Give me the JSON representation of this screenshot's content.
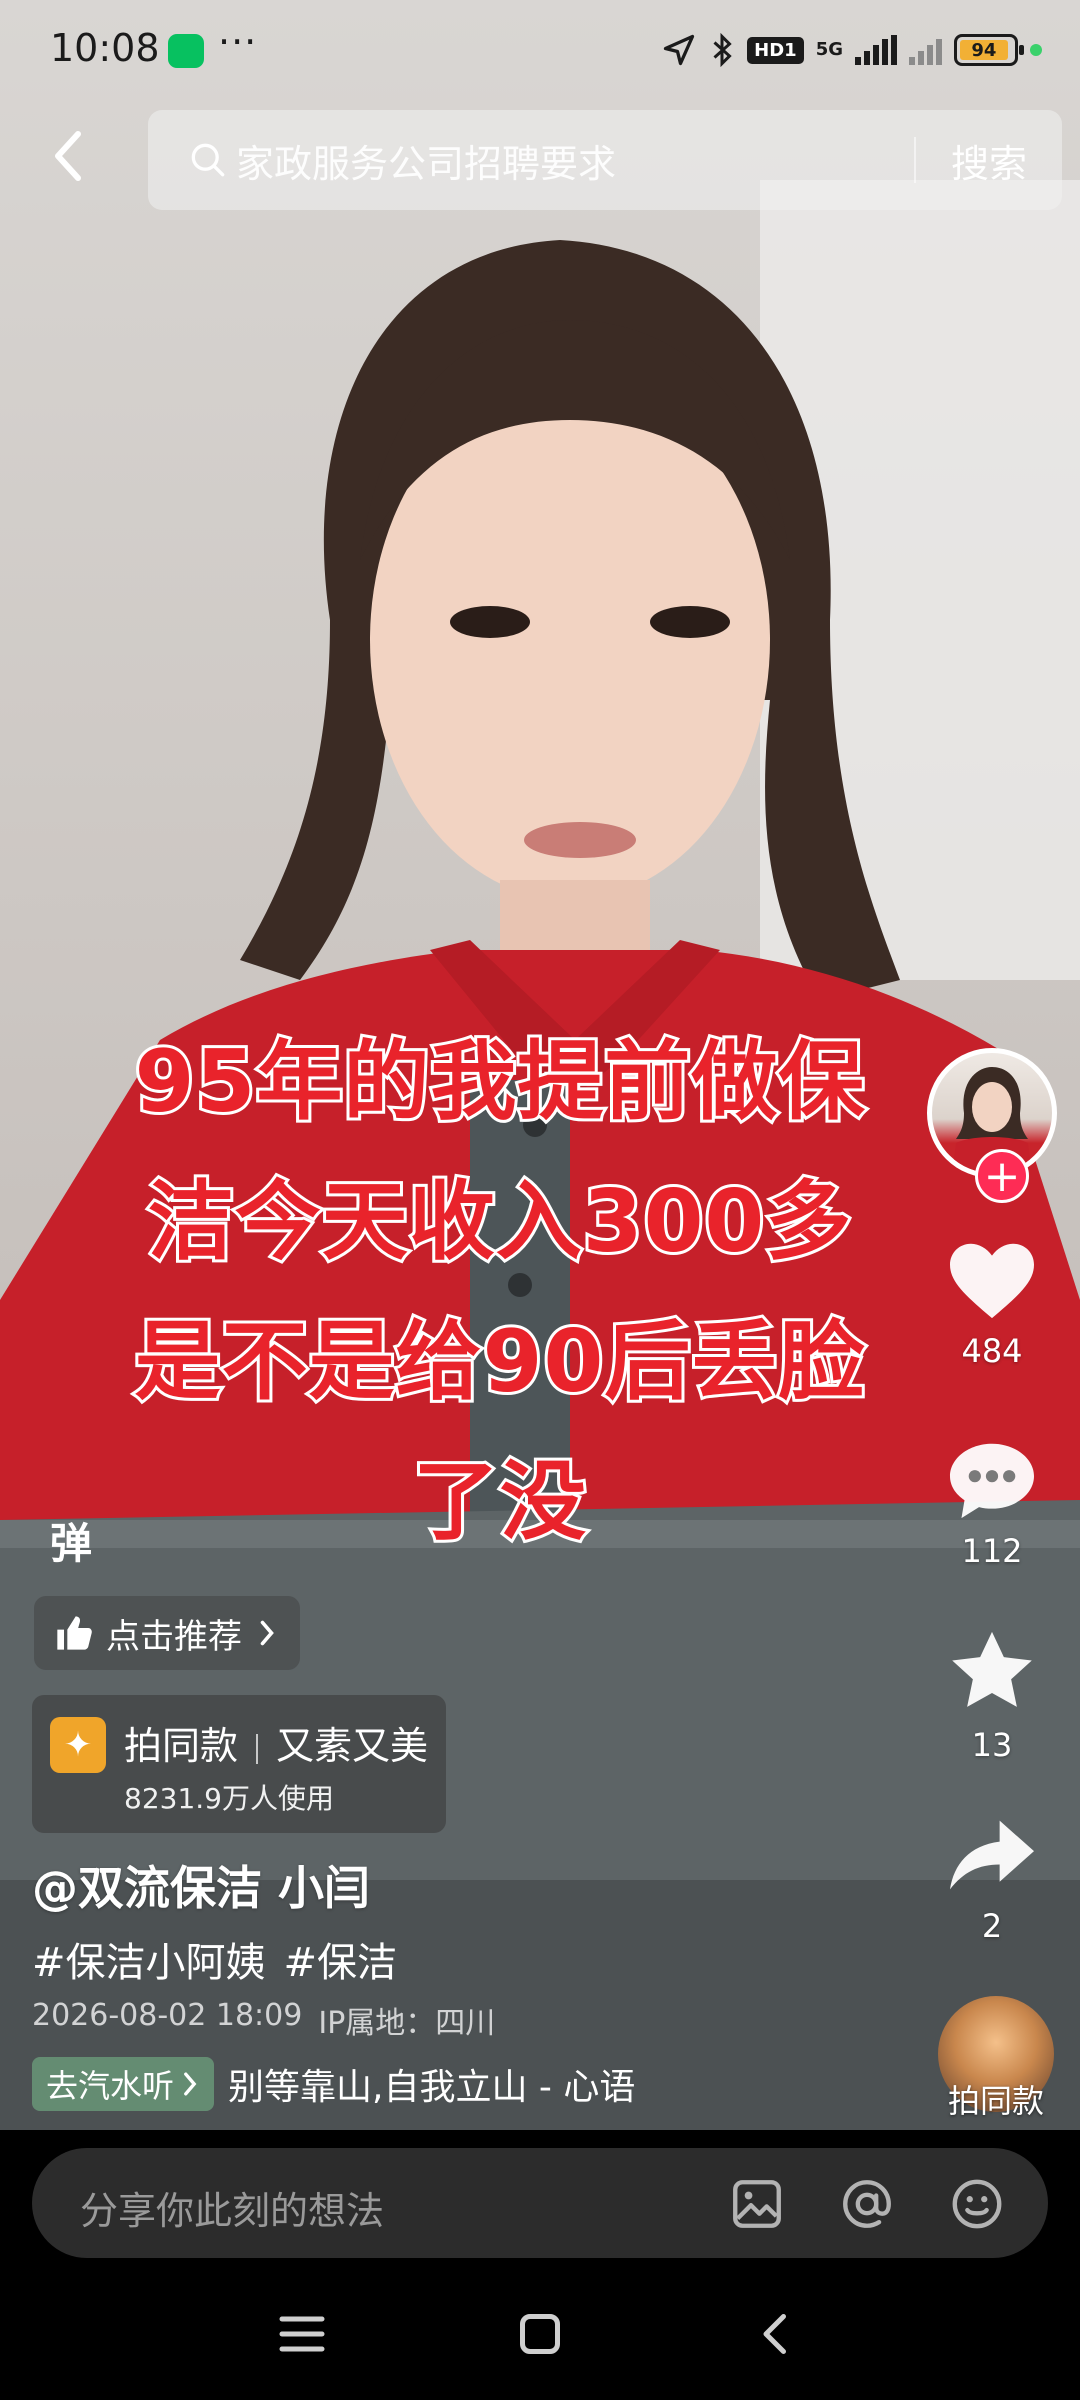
{
  "status_bar": {
    "time": "10:08",
    "more": "···",
    "hd_badge": "HD1",
    "network": "5G",
    "battery": "94"
  },
  "search": {
    "placeholder": "家政服务公司招聘要求",
    "button_label": "搜索"
  },
  "caption_lines": [
    "95年的我提前做保",
    "洁今天收入300多",
    "是不是给90后丢脸",
    "了没"
  ],
  "rail": {
    "follow_symbol": "+",
    "likes": "484",
    "comments": "112",
    "favorites": "13",
    "shares": "2",
    "same_style_label": "拍同款"
  },
  "overlay": {
    "danmaku_label": "弹",
    "recommend_label": "点击推荐",
    "template_action": "拍同款",
    "template_name": "又素又美",
    "template_usage": "8231.9万人使用"
  },
  "post": {
    "author": "@双流保洁 小闫",
    "hashtags": [
      "#保洁小阿姨",
      "#保洁"
    ],
    "datetime": "2026-08-02 18:09",
    "ip_location": "IP属地：四川",
    "music_tag": "去汽水听",
    "music_title": "别等靠山,自我立山 - 心语"
  },
  "comment_input": {
    "placeholder": "分享你此刻的想法"
  },
  "colors": {
    "caption_red": "#e9232b",
    "follow_pink": "#fe2c55",
    "template_icon": "#f0a52a"
  },
  "icons": [
    "back-arrow-icon",
    "search-icon",
    "heart-icon",
    "comment-bubble-icon",
    "star-icon",
    "share-arrow-icon",
    "thumbs-up-icon",
    "chevron-right-icon",
    "sparkle-icon",
    "image-icon",
    "at-icon",
    "emoji-icon",
    "menu-icon",
    "home-square-icon",
    "back-triangle-icon"
  ]
}
